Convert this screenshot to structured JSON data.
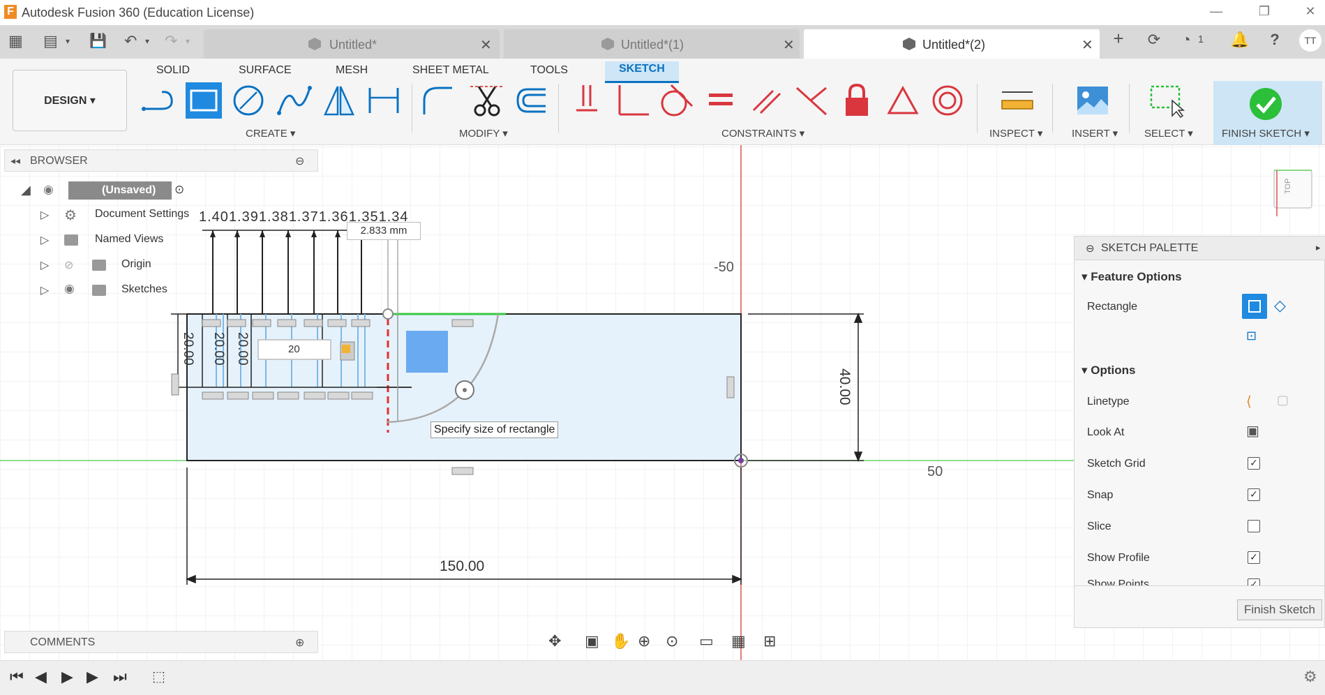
{
  "window": {
    "title": "Autodesk Fusion 360 (Education License)",
    "logo_letter": "F",
    "min": "—",
    "restore": "❐",
    "close": "✕"
  },
  "quick_access": {
    "grid": "▦",
    "file": "▤",
    "save": "💾",
    "undo": "↶",
    "redo": "↷"
  },
  "tabs": [
    {
      "label": "Untitled*",
      "active": false
    },
    {
      "label": "Untitled*(1)",
      "active": false
    },
    {
      "label": "Untitled*(2)",
      "active": true
    }
  ],
  "tab_icons": {
    "new_tab": "+",
    "jobs_count": "1",
    "help": "?",
    "user": "TT"
  },
  "ribbon": {
    "workspace": "DESIGN ▾",
    "tabs": [
      "SOLID",
      "SURFACE",
      "MESH",
      "SHEET METAL",
      "TOOLS",
      "SKETCH"
    ],
    "active_tab": "SKETCH",
    "groups": {
      "create": "CREATE ▾",
      "modify": "MODIFY ▾",
      "constraints": "CONSTRAINTS ▾",
      "inspect": "INSPECT ▾",
      "insert": "INSERT ▾",
      "select": "SELECT ▾",
      "finish": "FINISH SKETCH ▾"
    }
  },
  "browser": {
    "title": "BROWSER",
    "root": "(Unsaved)",
    "items": [
      "Document Settings",
      "Named Views",
      "Origin",
      "Sketches"
    ]
  },
  "sketch": {
    "dimension_tooltip": "2.833 mm",
    "input_value": "20",
    "hint": "Specify size of rectangle",
    "axis_label_top": "-50",
    "axis_label_right": "50",
    "dim_width": "150.00",
    "dim_height": "40.00",
    "vertical_dims": [
      "20.00",
      "20.00",
      "20.00"
    ],
    "top_dims": [
      "1.40",
      "1.39",
      "1.38",
      "1.37",
      "1.36",
      "1.35",
      "1.34"
    ],
    "viewcube": "TOP"
  },
  "palette": {
    "title": "SKETCH PALETTE",
    "feature_options": "Feature Options",
    "rectangle": "Rectangle",
    "options": "Options",
    "rows": [
      {
        "label": "Linetype",
        "type": "icon"
      },
      {
        "label": "Look At",
        "type": "icon"
      },
      {
        "label": "Sketch Grid",
        "type": "check",
        "checked": true
      },
      {
        "label": "Snap",
        "type": "check",
        "checked": true
      },
      {
        "label": "Slice",
        "type": "check",
        "checked": false
      },
      {
        "label": "Show Profile",
        "type": "check",
        "checked": true
      },
      {
        "label": "Show Points",
        "type": "check",
        "checked": true
      }
    ],
    "finish_button": "Finish Sketch"
  },
  "comments": {
    "title": "COMMENTS"
  },
  "colors": {
    "accent": "#0a72c2",
    "sketch_fill": "#e6f2fb",
    "axis_red": "#e05050",
    "axis_green": "#6cd16c",
    "finish_green": "#2bbf3a"
  }
}
